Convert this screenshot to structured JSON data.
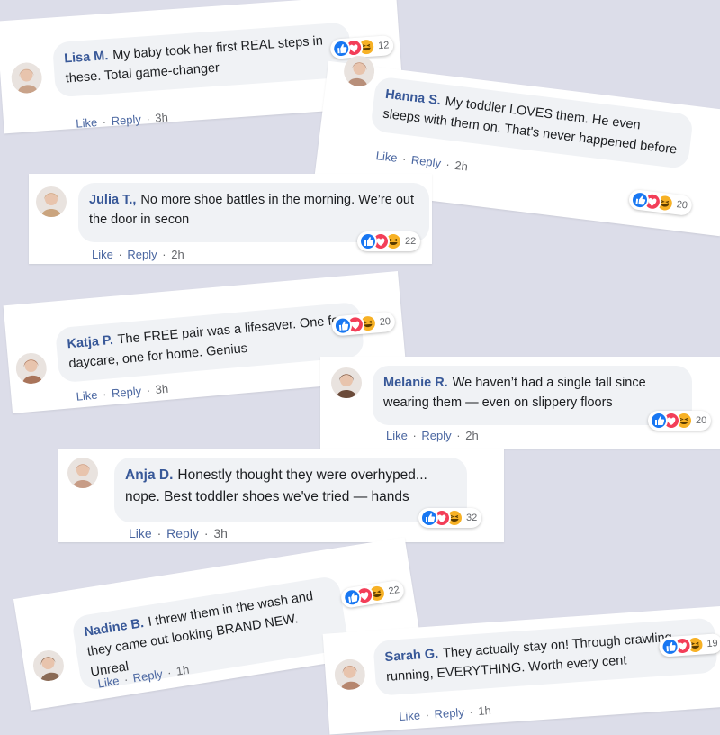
{
  "like_label": "Like",
  "reply_label": "Reply",
  "colors": {
    "background": "#dcdde9",
    "author": "#385898",
    "like": "#1877f2",
    "love": "#f33e58",
    "haha": "#f7b125"
  },
  "reaction_icons": [
    "like-icon",
    "love-icon",
    "haha-icon"
  ],
  "comments": [
    {
      "author": "Lisa M.",
      "text": "My baby took her first REAL steps in these. Total game-changer",
      "time": "3h",
      "reactions": "12"
    },
    {
      "author": "Hanna S.",
      "text": "My toddler LOVES them. He even sleeps with them on. That's never happened before",
      "time": "2h",
      "reactions": "20"
    },
    {
      "author": "Julia T.,",
      "text": "No more shoe battles in the morning. We’re out the door in secon",
      "time": "2h",
      "reactions": "22"
    },
    {
      "author": "Katja P.",
      "text": "The FREE pair was a lifesaver. One for daycare, one for home. Genius",
      "time": "3h",
      "reactions": "20"
    },
    {
      "author": "Melanie R.",
      "text": "We haven’t had a single fall since wearing them — even on slippery floors",
      "time": "2h",
      "reactions": "20"
    },
    {
      "author": "Anja D.",
      "text": "Honestly thought they were overhyped... nope. Best toddler shoes we've tried — hands",
      "time": "3h",
      "reactions": "32"
    },
    {
      "author": "Nadine B.",
      "text": "I threw them in the wash and they came out looking BRAND NEW. Unreal",
      "time": "1h",
      "reactions": "22"
    },
    {
      "author": "Sarah G.",
      "text": "They actually stay on! Through crawling, running, EVERYTHING. Worth every cent",
      "time": "1h",
      "reactions": "19"
    }
  ]
}
